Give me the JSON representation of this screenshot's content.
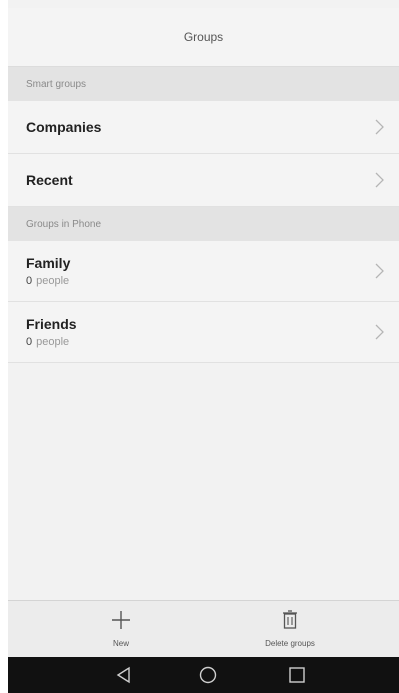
{
  "header": {
    "title": "Groups"
  },
  "smart_groups": {
    "section_label": "Smart groups",
    "items": [
      {
        "label": "Companies"
      },
      {
        "label": "Recent"
      }
    ]
  },
  "phone_groups": {
    "section_label": "Groups in Phone",
    "items": [
      {
        "label": "Family",
        "count": "0",
        "unit": "people"
      },
      {
        "label": "Friends",
        "count": "0",
        "unit": "people"
      }
    ]
  },
  "toolbar": {
    "new_label": "New",
    "delete_label": "Delete groups"
  },
  "icons": {
    "chevron": "chevron-right-icon",
    "new": "plus-icon",
    "delete": "trash-icon",
    "nav_back": "back-triangle-icon",
    "nav_home": "home-circle-icon",
    "nav_recent": "recent-square-icon"
  }
}
